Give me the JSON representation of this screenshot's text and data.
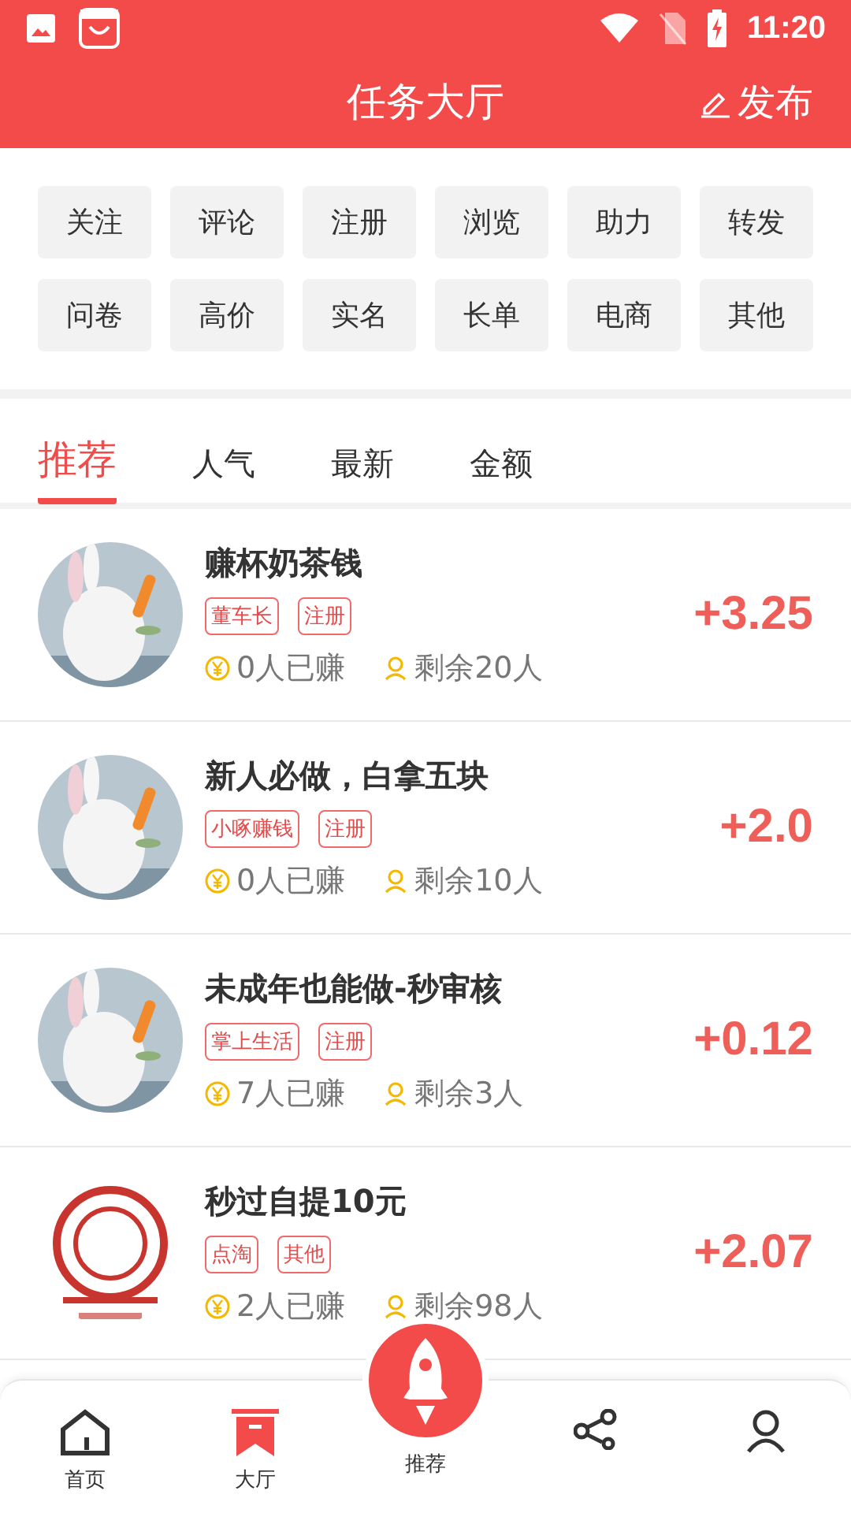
{
  "status_bar": {
    "time": "11:20"
  },
  "header": {
    "title": "任务大厅",
    "publish": "发布"
  },
  "categories": [
    "关注",
    "评论",
    "注册",
    "浏览",
    "助力",
    "转发",
    "问卷",
    "高价",
    "实名",
    "长单",
    "电商",
    "其他"
  ],
  "tabs": [
    {
      "label": "推荐",
      "selected": true
    },
    {
      "label": "人气",
      "selected": false
    },
    {
      "label": "最新",
      "selected": false
    },
    {
      "label": "金额",
      "selected": false
    }
  ],
  "tasks": [
    {
      "title": "赚杯奶茶钱",
      "tags": [
        "董车长",
        "注册"
      ],
      "earned": "0人已赚",
      "remaining": "剩余20人",
      "reward": "+3.25"
    },
    {
      "title": "新人必做，白拿五块",
      "tags": [
        "小啄赚钱",
        "注册"
      ],
      "earned": "0人已赚",
      "remaining": "剩余10人",
      "reward": "+2.0"
    },
    {
      "title": "未成年也能做-秒审核",
      "tags": [
        "掌上生活",
        "注册"
      ],
      "earned": "7人已赚",
      "remaining": "剩余3人",
      "reward": "+0.12"
    },
    {
      "title": "秒过自提10元",
      "tags": [
        "点淘",
        "其他"
      ],
      "earned": "2人已赚",
      "remaining": "剩余98人",
      "reward": "+2.07"
    }
  ],
  "bottom_nav": [
    {
      "label": "首页",
      "selected": false
    },
    {
      "label": "大厅",
      "selected": true
    },
    {
      "label": "推荐",
      "selected": false
    },
    {
      "selected": false
    },
    {
      "selected": false
    }
  ]
}
